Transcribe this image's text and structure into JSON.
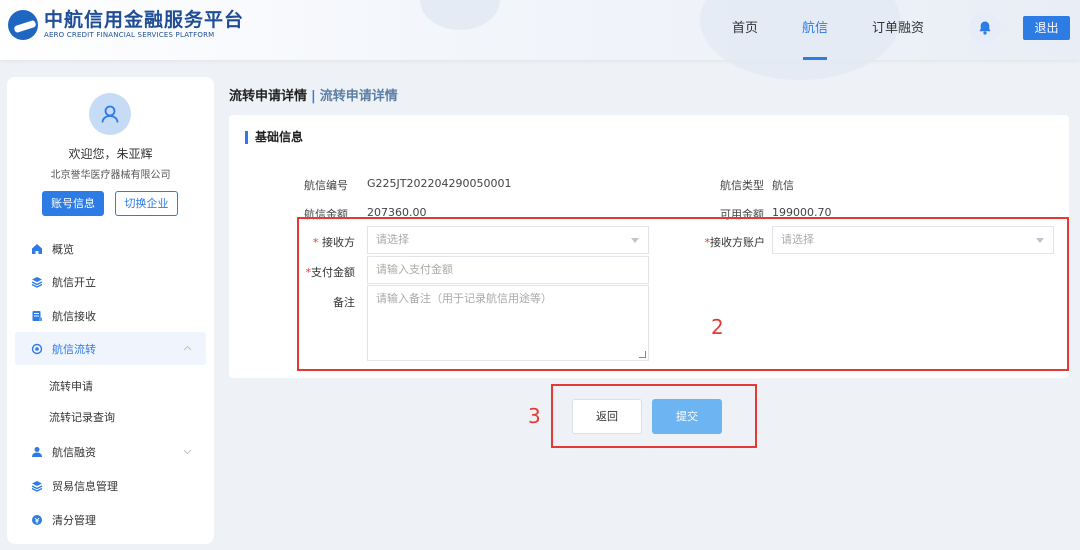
{
  "header": {
    "logo_cn": "中航信用金融服务平台",
    "logo_en": "AERO CREDIT FINANCIAL SERVICES PLATFORM",
    "nav": [
      "首页",
      "航信",
      "订单融资"
    ],
    "active_nav": "航信",
    "logout_label": "退出",
    "bell_icon": "bell-icon"
  },
  "sidebar": {
    "welcome": "欢迎您，朱亚辉",
    "company": "北京誉华医疗器械有限公司",
    "account_btn": "账号信息",
    "switch_btn": "切换企业",
    "menu": [
      {
        "label": "概览",
        "icon": "home-icon"
      },
      {
        "label": "航信开立",
        "icon": "layers-icon"
      },
      {
        "label": "航信接收",
        "icon": "document-icon"
      },
      {
        "label": "航信流转",
        "icon": "flow-icon",
        "active": true
      },
      {
        "label": "航信融资",
        "icon": "finance-icon"
      },
      {
        "label": "贸易信息管理",
        "icon": "layers-icon"
      },
      {
        "label": "清分管理",
        "icon": "clearing-icon"
      }
    ],
    "submenu": [
      "流转申请",
      "流转记录查询"
    ]
  },
  "breadcrumb": {
    "current": "流转申请详情",
    "sep": "|",
    "sub": "流转申请详情"
  },
  "section_title": "基础信息",
  "info": {
    "hx_no_label": "航信编号",
    "hx_no": "G225JT202204290050001",
    "hx_type_label": "航信类型",
    "hx_type": "航信",
    "hx_amount_label": "航信金额",
    "hx_amount": "207360.00",
    "avail_label": "可用金额",
    "avail": "199000.70"
  },
  "form": {
    "receiver_label": "接收方",
    "receiver_placeholder": "请选择",
    "receiver_account_label": "接收方账户",
    "receiver_account_placeholder": "请选择",
    "pay_label": "支付金额",
    "pay_placeholder": "请输入支付金额",
    "remark_label": "备注",
    "remark_placeholder": "请输入备注（用于记录航信用途等）",
    "required_mark": "*"
  },
  "annotations": {
    "n2": "2",
    "n3": "3"
  },
  "actions": {
    "back": "返回",
    "submit": "提交"
  },
  "colors": {
    "primary": "#2d7be5",
    "annotation": "#e53935",
    "submit": "#6db4f3"
  }
}
